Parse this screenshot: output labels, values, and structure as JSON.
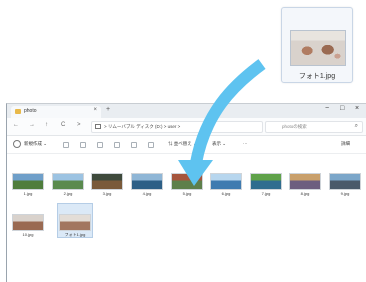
{
  "dragged_file": {
    "name": "フォト1.jpg"
  },
  "window": {
    "tab_title": "photo",
    "tab_close": "×",
    "new_tab": "+",
    "controls": {
      "minimize": "−",
      "maximize": "□",
      "close": "×"
    },
    "nav": {
      "back": "←",
      "forward": "→",
      "up": "↑",
      "refresh": "C",
      "more": ">"
    },
    "address": {
      "crumbs": ">  リムーバブル ディスク (D:)  >  user  >"
    },
    "search": {
      "placeholder": "photoの検索",
      "icon": "⌕"
    },
    "commands": {
      "new": "新規作成 ⌄",
      "sort": "⇅ 並べ替え ⌄",
      "view": "表示 ⌄",
      "more": "···",
      "details": "詳細"
    }
  },
  "files": [
    {
      "label": "1.jpg",
      "icon": "landscape-thumbnail",
      "colors": [
        "#6f9fc9",
        "#4f7d3c"
      ]
    },
    {
      "label": "2.jpg",
      "icon": "landscape-thumbnail",
      "colors": [
        "#9cc3e2",
        "#5a8a4e"
      ]
    },
    {
      "label": "3.jpg",
      "icon": "landscape-thumbnail",
      "colors": [
        "#3e4a3c",
        "#7a5a3a"
      ]
    },
    {
      "label": "4.jpg",
      "icon": "landscape-thumbnail",
      "colors": [
        "#8fb6d6",
        "#2d5f86"
      ]
    },
    {
      "label": "5.jpg",
      "icon": "landscape-thumbnail",
      "colors": [
        "#a6553d",
        "#5d7f4b"
      ]
    },
    {
      "label": "6.jpg",
      "icon": "landscape-thumbnail",
      "colors": [
        "#b7d6ee",
        "#3f7bb0"
      ]
    },
    {
      "label": "7.jpg",
      "icon": "landscape-thumbnail",
      "colors": [
        "#5fa24a",
        "#2f6d8f"
      ]
    },
    {
      "label": "8.jpg",
      "icon": "landscape-thumbnail",
      "colors": [
        "#c9a06b",
        "#6d5f7f"
      ]
    },
    {
      "label": "9.jpg",
      "icon": "landscape-thumbnail",
      "colors": [
        "#7ba6c9",
        "#4a5a6a"
      ]
    },
    {
      "label": "10.jpg",
      "icon": "photo-thumbnail",
      "colors": [
        "#d9d2cc",
        "#9a6a52"
      ]
    },
    {
      "label": "フォト1.jpg",
      "icon": "photo-thumbnail",
      "colors": [
        "#e3ddd7",
        "#a27660"
      ]
    }
  ]
}
